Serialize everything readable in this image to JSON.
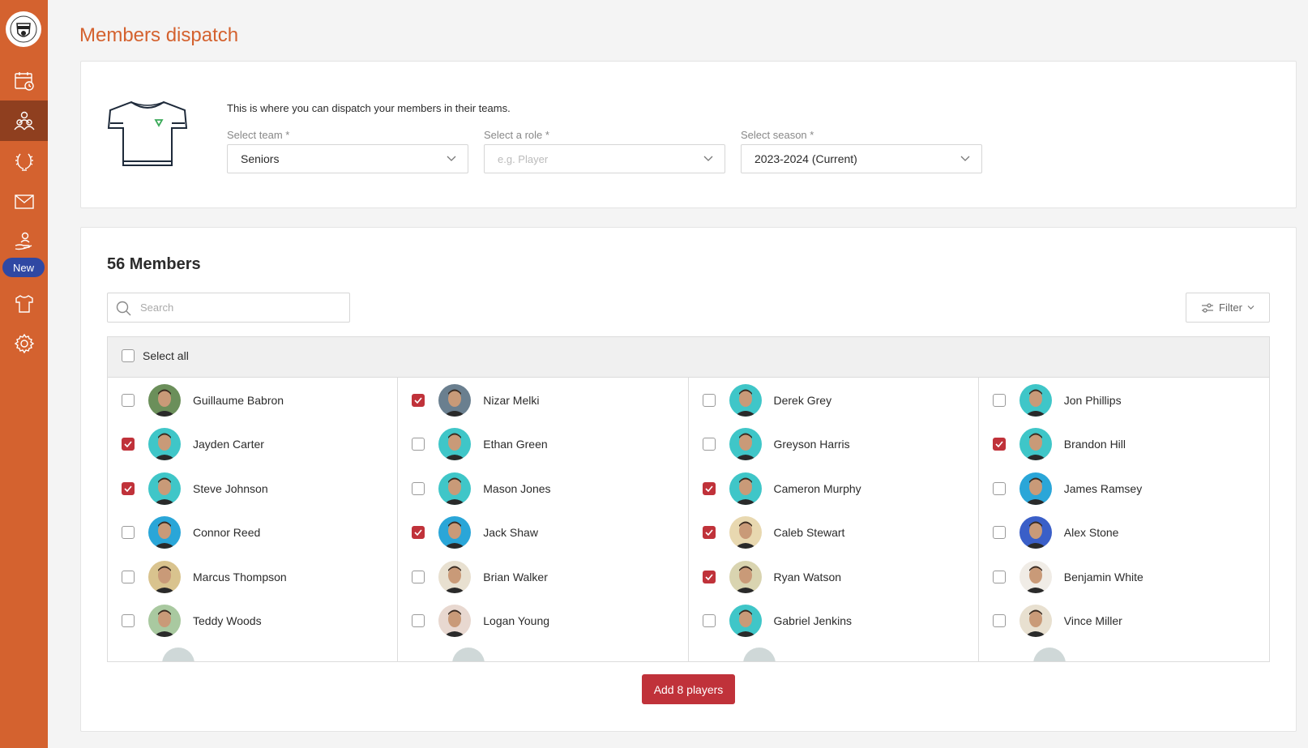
{
  "page": {
    "title": "Members dispatch"
  },
  "sidebar": {
    "new_badge": "New",
    "items": [
      {
        "icon": "calendar-icon"
      },
      {
        "icon": "members-icon",
        "active": true
      },
      {
        "icon": "laurel-icon"
      },
      {
        "icon": "mail-icon"
      },
      {
        "icon": "hand-person-icon"
      },
      {
        "icon": "shirt-icon"
      },
      {
        "icon": "gear-icon"
      }
    ]
  },
  "dispatch": {
    "intro": "This is where you can dispatch your members in their teams.",
    "team": {
      "label": "Select team *",
      "value": "Seniors"
    },
    "role": {
      "label": "Select a role *",
      "placeholder": "e.g. Player"
    },
    "season": {
      "label": "Select season *",
      "value": "2023-2024 (Current)"
    }
  },
  "members": {
    "title": "56 Members",
    "search_placeholder": "Search",
    "filter_label": "Filter",
    "select_all_label": "Select all",
    "add_button": "Add 8 players",
    "columns": [
      [
        {
          "name": "Guillaume Babron",
          "checked": false,
          "bg": "#6b8f5a"
        },
        {
          "name": "Jayden Carter",
          "checked": true,
          "bg": "#3fc6c8"
        },
        {
          "name": "Steve Johnson",
          "checked": true,
          "bg": "#3fc6c8"
        },
        {
          "name": "Connor Reed",
          "checked": false,
          "bg": "#2aa6d8"
        },
        {
          "name": "Marcus Thompson",
          "checked": false,
          "bg": "#d9c38e"
        },
        {
          "name": "Teddy Woods",
          "checked": false,
          "bg": "#a9c9a0"
        }
      ],
      [
        {
          "name": "Nizar Melki",
          "checked": true,
          "bg": "#6a7f8f"
        },
        {
          "name": "Ethan Green",
          "checked": false,
          "bg": "#3fc6c8"
        },
        {
          "name": "Mason Jones",
          "checked": false,
          "bg": "#3fc6c8"
        },
        {
          "name": "Jack Shaw",
          "checked": true,
          "bg": "#2aa6d8"
        },
        {
          "name": "Brian Walker",
          "checked": false,
          "bg": "#e8e0d0"
        },
        {
          "name": "Logan Young",
          "checked": false,
          "bg": "#e8d8d0"
        }
      ],
      [
        {
          "name": "Derek Grey",
          "checked": false,
          "bg": "#3fc6c8"
        },
        {
          "name": "Greyson Harris",
          "checked": false,
          "bg": "#3fc6c8"
        },
        {
          "name": "Cameron Murphy",
          "checked": true,
          "bg": "#3fc6c8"
        },
        {
          "name": "Caleb Stewart",
          "checked": true,
          "bg": "#e8d8b0"
        },
        {
          "name": "Ryan Watson",
          "checked": true,
          "bg": "#d9d4b0"
        },
        {
          "name": "Gabriel Jenkins",
          "checked": false,
          "bg": "#3fc6c8"
        }
      ],
      [
        {
          "name": "Jon Phillips",
          "checked": false,
          "bg": "#3fc6c8"
        },
        {
          "name": "Brandon Hill",
          "checked": true,
          "bg": "#3fc6c8"
        },
        {
          "name": "James Ramsey",
          "checked": false,
          "bg": "#2aa6d8"
        },
        {
          "name": "Alex Stone",
          "checked": false,
          "bg": "#3a5fc8"
        },
        {
          "name": "Benjamin White",
          "checked": false,
          "bg": "#f0ece6"
        },
        {
          "name": "Vince Miller",
          "checked": false,
          "bg": "#e8e0d0"
        }
      ]
    ]
  },
  "colors": {
    "brand_orange": "#d4622f",
    "active_nav": "#8f3f1f",
    "checkbox_checked": "#c0323a",
    "new_badge": "#2f48a3"
  }
}
